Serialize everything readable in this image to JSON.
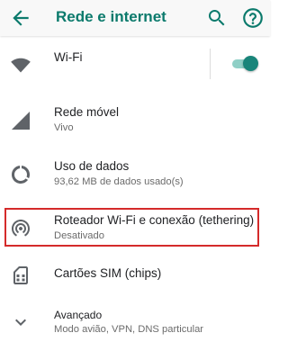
{
  "header": {
    "title": "Rede e internet",
    "back_icon": "arrow-back-icon",
    "search_icon": "search-icon",
    "help_icon": "help-icon"
  },
  "items": [
    {
      "icon": "wifi-icon",
      "label": "Wi-Fi",
      "toggle": {
        "on": true
      }
    },
    {
      "icon": "cellular-signal-icon",
      "label": "Rede móvel",
      "sub": "Vivo"
    },
    {
      "icon": "data-usage-icon",
      "label": "Uso de dados",
      "sub": "93,62 MB de dados usado(s)"
    },
    {
      "icon": "hotspot-icon",
      "label": "Roteador Wi-Fi e conexão (tethering)",
      "sub": "Desativado",
      "highlighted": true
    },
    {
      "icon": "sim-card-icon",
      "label": "Cartões SIM (chips)"
    },
    {
      "icon": "chevron-down-icon",
      "label": "Avançado",
      "sub": "Modo avião, VPN, DNS particular"
    }
  ],
  "colors": {
    "accent": "#0b7a6c",
    "toggle_thumb": "#19857a",
    "toggle_track": "#8fcfc6",
    "highlight_border": "#d42a2a",
    "icon": "#5f6368"
  }
}
